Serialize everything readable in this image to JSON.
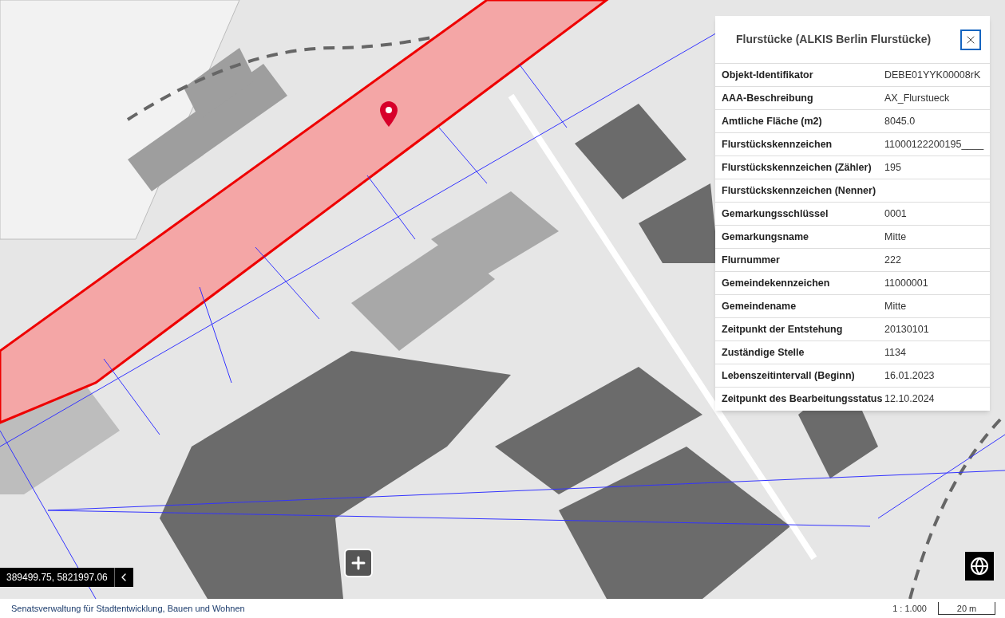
{
  "popup": {
    "title": "Flurstücke (ALKIS Berlin Flurstücke)",
    "rows": [
      {
        "label": "Objekt-Identifikator",
        "value": "DEBE01YYK00008rK"
      },
      {
        "label": "AAA-Beschreibung",
        "value": "AX_Flurstueck"
      },
      {
        "label": "Amtliche Fläche (m2)",
        "value": "8045.0"
      },
      {
        "label": "Flurstückskennzeichen",
        "value": "11000122200195____"
      },
      {
        "label": "Flurstückskennzeichen (Zähler)",
        "value": "195"
      },
      {
        "label": "Flurstückskennzeichen (Nenner)"
      },
      {
        "label": "Gemarkungsschlüssel",
        "value": "0001"
      },
      {
        "label": "Gemarkungsname",
        "value": "Mitte"
      },
      {
        "label": "Flurnummer",
        "value": "222"
      },
      {
        "label": "Gemeindekennzeichen",
        "value": "11000001"
      },
      {
        "label": "Gemeindename",
        "value": "Mitte"
      },
      {
        "label": "Zeitpunkt der Entstehung",
        "value": "20130101"
      },
      {
        "label": "Zuständige Stelle",
        "value": "1134"
      },
      {
        "label": "Lebenszeitintervall (Beginn)",
        "value": "16.01.2023"
      },
      {
        "label": "Zeitpunkt des Bearbeitungsstatus",
        "value": "12.10.2024"
      }
    ]
  },
  "coordinates": "389499.75, 5821997.06",
  "status_bar": {
    "attribution": "Senatsverwaltung für Stadtentwicklung, Bauen und Wohnen",
    "scale": "1 : 1.000",
    "scale_bar": "20 m"
  }
}
